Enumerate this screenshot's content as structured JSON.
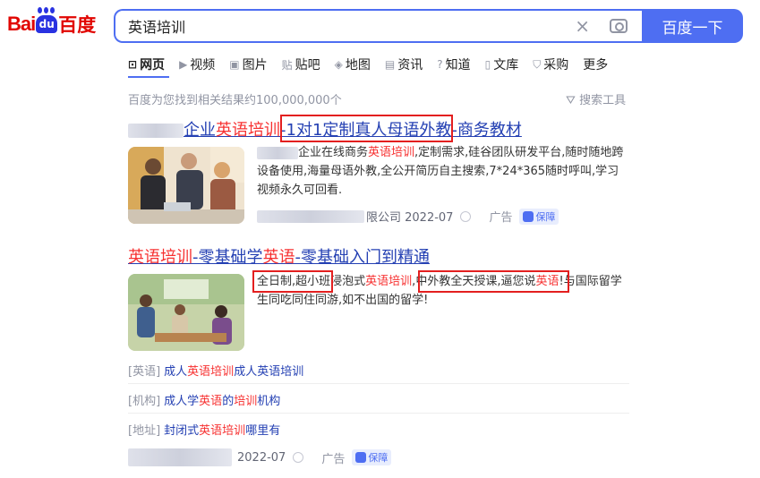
{
  "logo": {
    "bai": "Bai",
    "du": "du",
    "cn": "百度"
  },
  "search": {
    "query": "英语培训",
    "button": "百度一下",
    "clear": "×"
  },
  "tabs": [
    {
      "icon": "⊡",
      "label": "网页"
    },
    {
      "icon": "▶",
      "label": "视频"
    },
    {
      "icon": "▣",
      "label": "图片"
    },
    {
      "icon": "贴",
      "label": "贴吧"
    },
    {
      "icon": "◈",
      "label": "地图"
    },
    {
      "icon": "▤",
      "label": "资讯"
    },
    {
      "icon": "?",
      "label": "知道"
    },
    {
      "icon": "▯",
      "label": "文库"
    },
    {
      "icon": "⛉",
      "label": "采购"
    },
    {
      "icon": "",
      "label": "更多"
    }
  ],
  "result_count": "百度为您找到相关结果约100,000,000个",
  "search_tools": "搜索工具",
  "result1": {
    "title_pre": "企业",
    "title_hl": "英语培训",
    "title_sep": "-",
    "title_mid": "1对1定制真人母语外教",
    "title_end": "-商务教材",
    "text_a": "企业在线商务",
    "text_hl": "英语培训",
    "text_b": ",定制需求,硅谷团队研发平台,随时随地跨设备使用,海量母语外教,全公开简历自主搜索,7*24*365随时呼叫,学习视频永久可回看.",
    "meta_company": "限公司 2022-07",
    "ad": "广告",
    "badge": "保障"
  },
  "result2": {
    "title_hl1": "英语培训",
    "title_mid": "-零基础学",
    "title_hl2": "英语",
    "title_end": "-零基础入门到精通",
    "text_a": "全日制,超小班",
    "text_b": "浸泡式",
    "text_hl1": "英语培训",
    "text_c": ",",
    "text_d": "中外教全天授课,逼您说",
    "text_hl2": "英语",
    "text_e": "!",
    "text_f": "与国际留学生同吃同住同游,如不出国的留学!",
    "sub1": {
      "tag": "[英语]",
      "a": "成人",
      "hl": "英语培训",
      "b": "成人英语培训"
    },
    "sub2": {
      "tag": "[机构]",
      "a": "成人学",
      "hl1": "英语",
      "b": "的",
      "hl2": "培训",
      "c": "机构"
    },
    "sub3": {
      "tag": "[地址]",
      "a": "封闭式",
      "hl": "英语培训",
      "b": "哪里有"
    },
    "meta_date": "2022-07",
    "ad": "广告",
    "badge": "保障"
  }
}
